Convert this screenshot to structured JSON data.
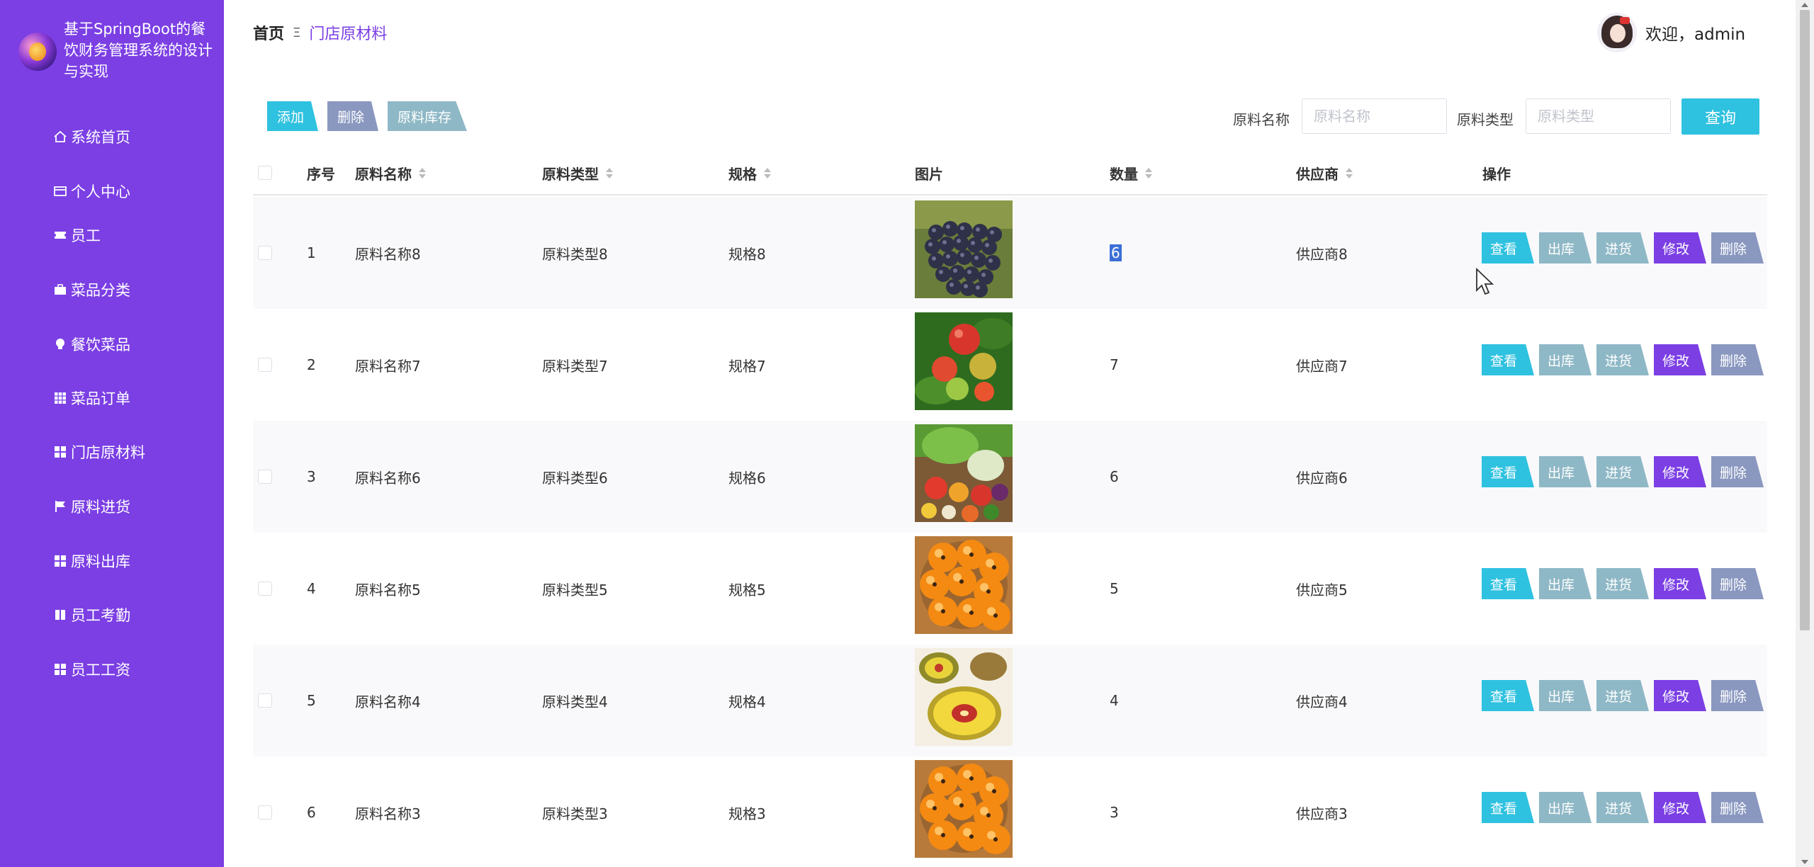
{
  "brand": {
    "title": "基于SpringBoot的餐饮财务管理系统的设计与实现"
  },
  "menu": [
    {
      "label": "系统首页",
      "icon": "home-icon"
    },
    {
      "label": "个人中心",
      "icon": "card-icon"
    },
    {
      "label": "员工",
      "icon": "ticket-icon"
    },
    {
      "label": "菜品分类",
      "icon": "briefcase-icon"
    },
    {
      "label": "餐饮菜品",
      "icon": "bulb-icon"
    },
    {
      "label": "菜品订单",
      "icon": "grid9-icon"
    },
    {
      "label": "门店原材料",
      "icon": "grid4-icon"
    },
    {
      "label": "原料进货",
      "icon": "flag-icon"
    },
    {
      "label": "原料出库",
      "icon": "grid4-icon"
    },
    {
      "label": "员工考勤",
      "icon": "book-icon"
    },
    {
      "label": "员工工资",
      "icon": "grid4-icon"
    }
  ],
  "breadcrumb": {
    "home": "首页",
    "separator": "Ξ",
    "current": "门店原材料"
  },
  "user": {
    "welcome": "欢迎，admin"
  },
  "toolbar": {
    "add": "添加",
    "delete": "删除",
    "stock": "原料库存",
    "name_label": "原料名称",
    "name_placeholder": "原料名称",
    "type_label": "原料类型",
    "type_placeholder": "原料类型",
    "query": "查询"
  },
  "colors": {
    "sidebar": "#7b3fe4",
    "primary": "#2fc1e0",
    "edit": "#7b3fe4",
    "muted": "#8fb8c6",
    "delete": "#8a98c0"
  },
  "table": {
    "headers": {
      "index": "序号",
      "name": "原料名称",
      "type": "原料类型",
      "spec": "规格",
      "image": "图片",
      "qty": "数量",
      "supplier": "供应商",
      "ops": "操作"
    },
    "actions": {
      "view": "查看",
      "out": "出库",
      "in": "进货",
      "edit": "修改",
      "delete": "删除"
    },
    "rows": [
      {
        "index": "1",
        "name": "原料名称8",
        "type": "原料类型8",
        "spec": "规格8",
        "image": "grapes",
        "qty": "6",
        "supplier": "供应商8"
      },
      {
        "index": "2",
        "name": "原料名称7",
        "type": "原料类型7",
        "spec": "规格7",
        "image": "tomatoes",
        "qty": "7",
        "supplier": "供应商7"
      },
      {
        "index": "3",
        "name": "原料名称6",
        "type": "原料类型6",
        "spec": "规格6",
        "image": "vegetables",
        "qty": "6",
        "supplier": "供应商6"
      },
      {
        "index": "4",
        "name": "原料名称5",
        "type": "原料类型5",
        "spec": "规格5",
        "image": "loquats",
        "qty": "5",
        "supplier": "供应商5"
      },
      {
        "index": "5",
        "name": "原料名称4",
        "type": "原料类型4",
        "spec": "规格4",
        "image": "kiwi",
        "qty": "4",
        "supplier": "供应商4"
      },
      {
        "index": "6",
        "name": "原料名称3",
        "type": "原料类型3",
        "spec": "规格3",
        "image": "loquats",
        "qty": "3",
        "supplier": "供应商3"
      }
    ]
  }
}
